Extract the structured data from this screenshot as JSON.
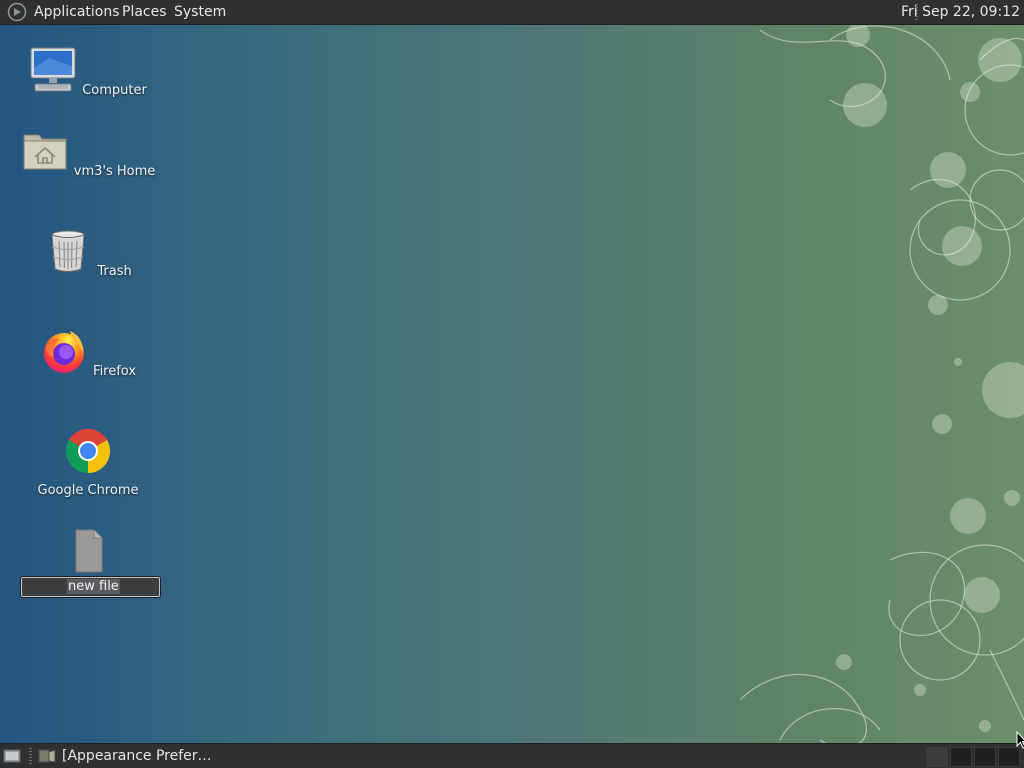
{
  "top_panel": {
    "menus": [
      "Applications",
      "Places",
      "System"
    ],
    "clock": "Fri Sep 22, 09:12"
  },
  "desktop": {
    "icons": [
      {
        "label": "Computer",
        "icon": "computer-icon"
      },
      {
        "label": "vm3's Home",
        "icon": "home-folder-icon"
      },
      {
        "label": "Trash",
        "icon": "trash-icon"
      },
      {
        "label": "Firefox",
        "icon": "firefox-icon"
      },
      {
        "label": "Google Chrome",
        "icon": "chrome-icon"
      },
      {
        "label": "new file",
        "icon": "document-icon",
        "renaming": true
      }
    ]
  },
  "bottom_panel": {
    "task": {
      "label": "[Appearance Prefer…",
      "icon": "appearance-preferences-icon"
    },
    "workspaces": 4
  },
  "colors": {
    "panel_bg": "#2e3032",
    "desktop_left": "#235580",
    "desktop_right": "#6b8f68"
  }
}
